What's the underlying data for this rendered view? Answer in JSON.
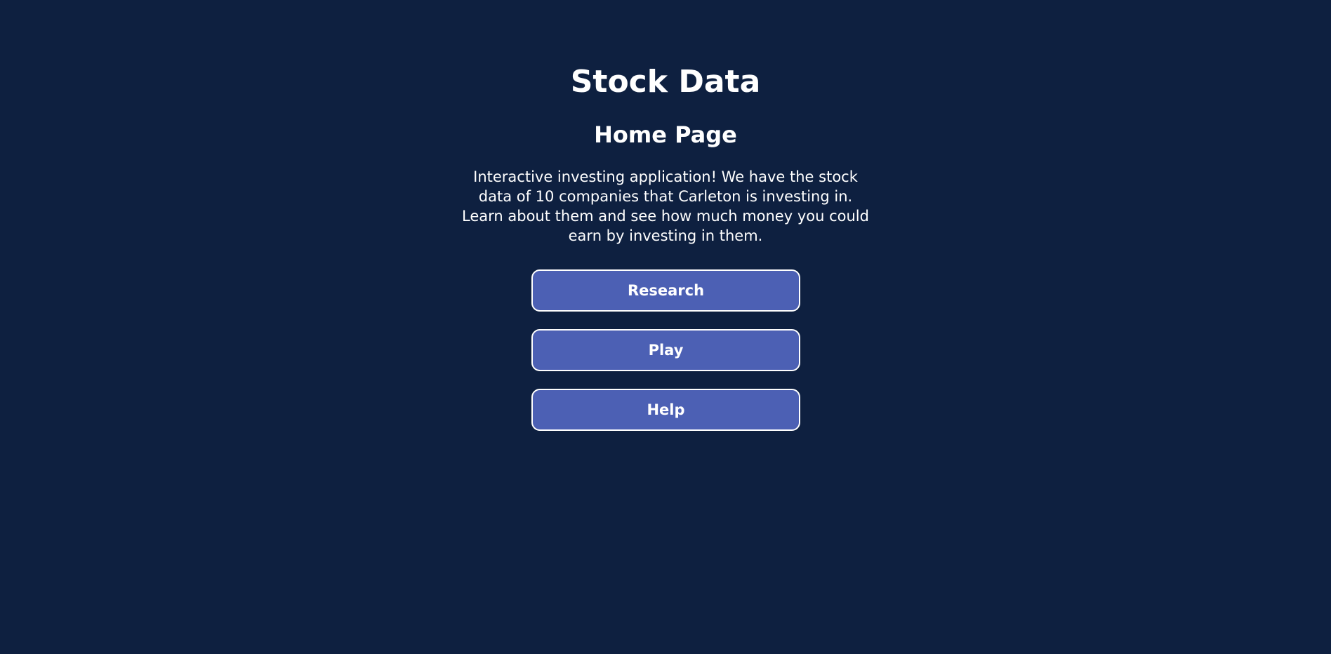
{
  "header": {
    "title": "Stock Data",
    "subtitle": "Home Page"
  },
  "intro": {
    "text": "Interactive investing application! We have the stock data of 10 companies that Carleton is investing in. Learn about them and see how much money you could earn by investing in them."
  },
  "nav": {
    "research_label": "Research",
    "play_label": "Play",
    "help_label": "Help"
  },
  "colors": {
    "background": "#0e2040",
    "button": "#4c60b4",
    "text": "#ffffff"
  }
}
